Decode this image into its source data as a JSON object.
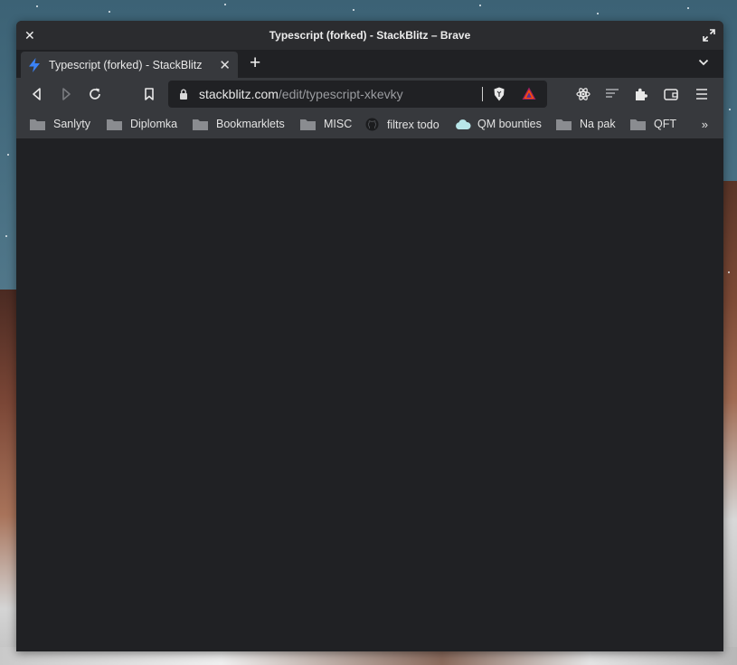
{
  "window": {
    "title": "Typescript (forked) - StackBlitz – Brave"
  },
  "tab": {
    "title": "Typescript (forked) - StackBlitz",
    "favicon": "lightning-bolt-icon",
    "favicon_color": "#3b82f6"
  },
  "url": {
    "host": "stackblitz.com",
    "path": "/edit/typescript-xkevky"
  },
  "toolbar_icons": [
    "back-icon",
    "forward-icon",
    "reload-icon",
    "bookmark-icon",
    "lock-icon",
    "brave-shields-icon",
    "brave-rewards-icon",
    "react-devtools-icon",
    "reading-list-icon",
    "extensions-icon",
    "wallet-icon",
    "menu-icon"
  ],
  "bookmarks": [
    {
      "label": "Sanlyty",
      "icon": "folder-icon"
    },
    {
      "label": "Diplomka",
      "icon": "folder-icon"
    },
    {
      "label": "Bookmarklets",
      "icon": "folder-icon"
    },
    {
      "label": "MISC",
      "icon": "folder-icon"
    },
    {
      "label": "filtrex todo",
      "icon": "github-icon"
    },
    {
      "label": "QM bounties",
      "icon": "cloud-icon"
    },
    {
      "label": "Na pak",
      "icon": "folder-icon"
    },
    {
      "label": "QFT",
      "icon": "folder-icon"
    }
  ],
  "bookmarks_overflow": "»",
  "colors": {
    "page_background": "#202124",
    "toolbar": "#37393d",
    "titlebar": "#2b2c2f"
  }
}
